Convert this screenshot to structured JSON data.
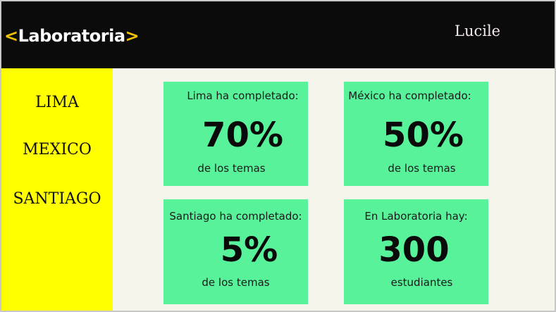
{
  "header": {
    "logo_text": "Laboratoria",
    "logo_left": "<",
    "logo_right": ">",
    "user_name": "Lucile"
  },
  "sidebar": {
    "items": [
      {
        "label": "LIMA"
      },
      {
        "label": "MEXICO"
      },
      {
        "label": "SANTIAGO"
      }
    ]
  },
  "cards": [
    {
      "title": "Lima ha completado:",
      "value": "70%",
      "caption": "de los temas"
    },
    {
      "title": "México ha completado:",
      "value": "50%",
      "caption": "de los temas"
    },
    {
      "title": "Santiago ha completado:",
      "value": "5%",
      "caption": "de los temas"
    },
    {
      "title": "En Laboratoria hay:",
      "value": "300",
      "caption": "estudiantes"
    }
  ],
  "colors": {
    "header_bg": "#0b0b0b",
    "sidebar_bg": "#ffff00",
    "card_bg": "#58f29a",
    "main_bg": "#f6f5ec",
    "logo_accent": "#f2c200"
  }
}
